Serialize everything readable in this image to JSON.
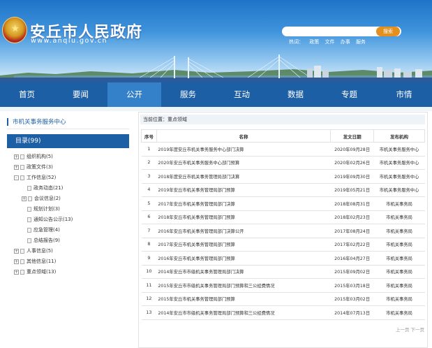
{
  "header": {
    "site_name": "安丘市人民政府",
    "site_url": "www.anqiu.gov.cn",
    "search_button": "搜索",
    "search_placeholder": "",
    "hot_label": "热词：",
    "hot_words": [
      "政策",
      "文件",
      "办事",
      "服务"
    ]
  },
  "nav": {
    "items": [
      "首页",
      "要闻",
      "公开",
      "服务",
      "互动",
      "数据",
      "专题",
      "市情"
    ],
    "active": "公开"
  },
  "sidebar": {
    "title": "市机关事务服务中心",
    "catalog": "目录(99)",
    "tree": [
      {
        "label": "组织机构(5)",
        "expand": "+",
        "level": 0
      },
      {
        "label": "政策文件(3)",
        "expand": "+",
        "level": 0
      },
      {
        "label": "工作信息(52)",
        "expand": "-",
        "level": 0
      },
      {
        "label": "政务动态(21)",
        "expand": "",
        "level": 1
      },
      {
        "label": "会议信息(2)",
        "expand": "+",
        "level": 1
      },
      {
        "label": "规划计划(3)",
        "expand": "",
        "level": 1
      },
      {
        "label": "通知公告公示(13)",
        "expand": "",
        "level": 1
      },
      {
        "label": "应急管理(4)",
        "expand": "",
        "level": 1
      },
      {
        "label": "总结报告(9)",
        "expand": "",
        "level": 1
      },
      {
        "label": "人事信息(5)",
        "expand": "+",
        "level": 0
      },
      {
        "label": "其他信息(11)",
        "expand": "+",
        "level": 0
      },
      {
        "label": "重点领域(13)",
        "expand": "+",
        "level": 0
      }
    ]
  },
  "main": {
    "breadcrumb": "当前位置：重点领域",
    "columns": [
      "序号",
      "名称",
      "发文日期",
      "发布机构"
    ],
    "rows": [
      {
        "num": "1",
        "title": "2019年度安丘市机关事务服务中心部门决算",
        "date": "2020年09月28日",
        "org": "市机关事务服务中心"
      },
      {
        "num": "2",
        "title": "2020年安丘市机关事务服务中心部门预算",
        "date": "2020年02月26日",
        "org": "市机关事务服务中心"
      },
      {
        "num": "3",
        "title": "2018年度安丘市机关事务管理局部门决算",
        "date": "2019年09月30日",
        "org": "市机关事务服务中心"
      },
      {
        "num": "4",
        "title": "2019年安丘市机关事务管理局部门预算",
        "date": "2019年05月21日",
        "org": "市机关事务服务中心"
      },
      {
        "num": "5",
        "title": "2017年安丘市机关事务管理局部门决算",
        "date": "2018年08月31日",
        "org": "市机关事务局"
      },
      {
        "num": "6",
        "title": "2018年安丘市机关事务管理局部门预算",
        "date": "2018年02月23日",
        "org": "市机关事务局"
      },
      {
        "num": "7",
        "title": "2016年安丘市机关事务管理局部门决算公开",
        "date": "2017年08月24日",
        "org": "市机关事务局"
      },
      {
        "num": "8",
        "title": "2017年安丘市机关事务管理局部门预算",
        "date": "2017年02月22日",
        "org": "市机关事务局"
      },
      {
        "num": "9",
        "title": "2016年安丘市机关事务管理局部门预算",
        "date": "2016年04月27日",
        "org": "市机关事务局"
      },
      {
        "num": "10",
        "title": "2014年安丘市市级机关事务管理局部门决算",
        "date": "2015年09月02日",
        "org": "市机关事务局"
      },
      {
        "num": "11",
        "title": "2015年安丘市市级机关事务管理局部门预算和三公经费情况",
        "date": "2015年03月18日",
        "org": "市机关事务局"
      },
      {
        "num": "12",
        "title": "2015年安丘市机关事务管理局部门预算",
        "date": "2015年03月02日",
        "org": "市机关事务局"
      },
      {
        "num": "13",
        "title": "2014年安丘市市级机关事务管理局部门预算和三公经费情况",
        "date": "2014年07月13日",
        "org": "市机关事务局"
      }
    ],
    "pager": {
      "prev": "上一页",
      "next": "下一页"
    }
  },
  "colors": {
    "nav_bg": "#1d5fa5",
    "nav_active": "#3581c9",
    "search_button": "#e3901e"
  }
}
